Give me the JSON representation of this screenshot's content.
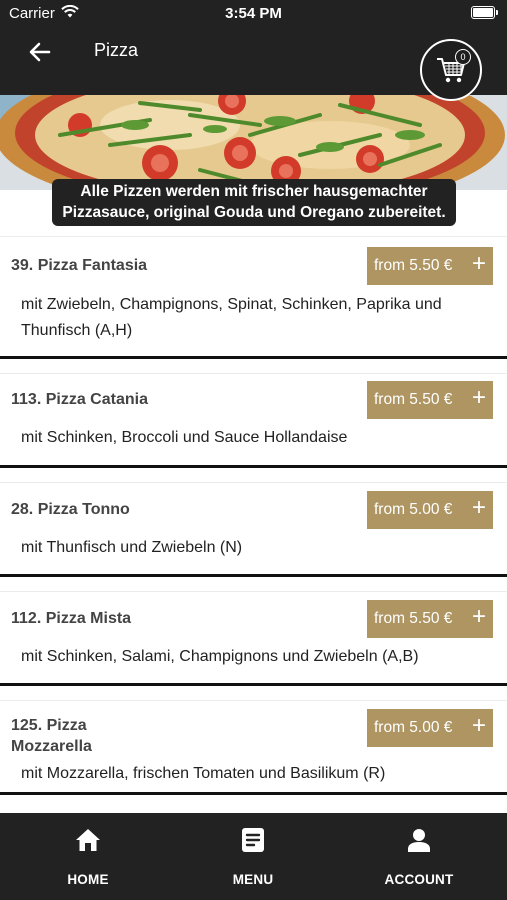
{
  "status_bar": {
    "carrier": "Carrier",
    "time": "3:54 PM"
  },
  "header": {
    "title": "Pizza",
    "cart_count": "0"
  },
  "banner": {
    "note_line1": "Alle Pizzen werden mit frischer hausgemachter",
    "note_line2": "Pizzasauce, original Gouda und Oregano zubereitet."
  },
  "products": [
    {
      "name": "39. Pizza Fantasia",
      "price": "from 5.50 €",
      "description": "mit Zwiebeln, Champignons, Spinat, Schinken, Paprika und Thunfisch (A,H)"
    },
    {
      "name": "113. Pizza Catania",
      "price": "from 5.50 €",
      "description": "mit Schinken, Broccoli und Sauce Hollandaise"
    },
    {
      "name": "28. Pizza Tonno",
      "price": "from 5.00 €",
      "description": "mit Thunfisch und Zwiebeln (N)"
    },
    {
      "name": "112. Pizza Mista",
      "price": "from 5.50 €",
      "description": "mit Schinken, Salami, Champignons und Zwiebeln (A,B)"
    },
    {
      "name": "125. Pizza Mozzarella",
      "price": "from 5.00 €",
      "description": "mit Mozzarella, frischen Tomaten und Basilikum (R)"
    }
  ],
  "bottom_nav": {
    "home": "HOME",
    "menu": "MENU",
    "account": "ACCOUNT"
  },
  "colors": {
    "header_bg": "#222222",
    "price_button": "#ae9562",
    "nav_bg": "#222222"
  }
}
